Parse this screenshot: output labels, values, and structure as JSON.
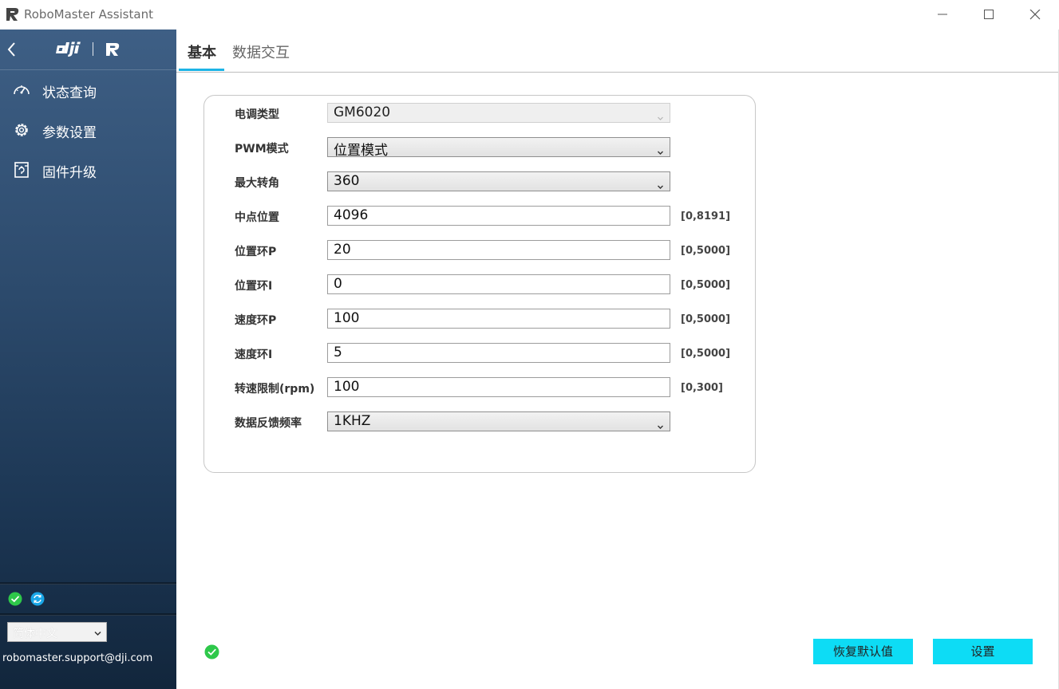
{
  "window": {
    "title": "RoboMaster Assistant"
  },
  "sidebar": {
    "nav": [
      {
        "label": "状态查询",
        "icon": "speedometer-icon"
      },
      {
        "label": "参数设置",
        "icon": "gear-icon"
      },
      {
        "label": "固件升级",
        "icon": "firmware-upgrade-icon"
      }
    ],
    "language": "简体中文",
    "support_email": "robomaster.support@dji.com"
  },
  "tabs": [
    {
      "label": "基本",
      "active": true
    },
    {
      "label": "数据交互",
      "active": false
    }
  ],
  "form": {
    "esc_type": {
      "label": "电调类型",
      "value": "GM6020"
    },
    "pwm_mode": {
      "label": "PWM模式",
      "value": "位置模式"
    },
    "max_angle": {
      "label": "最大转角",
      "value": "360"
    },
    "center_position": {
      "label": "中点位置",
      "value": "4096",
      "range": "[0,8191]"
    },
    "pos_loop_p": {
      "label": "位置环P",
      "value": "20",
      "range": "[0,5000]"
    },
    "pos_loop_i": {
      "label": "位置环I",
      "value": "0",
      "range": "[0,5000]"
    },
    "speed_loop_p": {
      "label": "速度环P",
      "value": "100",
      "range": "[0,5000]"
    },
    "speed_loop_i": {
      "label": "速度环I",
      "value": "5",
      "range": "[0,5000]"
    },
    "speed_limit": {
      "label": "转速限制(rpm)",
      "value": "100",
      "range": "[0,300]"
    },
    "feedback_freq": {
      "label": "数据反馈频率",
      "value": "1KHZ"
    }
  },
  "buttons": {
    "restore_default": "恢复默认值",
    "apply": "设置"
  },
  "colors": {
    "accent": "#1db4e6",
    "button": "#0ddcf5",
    "status_ok": "#2ec84a",
    "sync": "#1aa7e8"
  }
}
